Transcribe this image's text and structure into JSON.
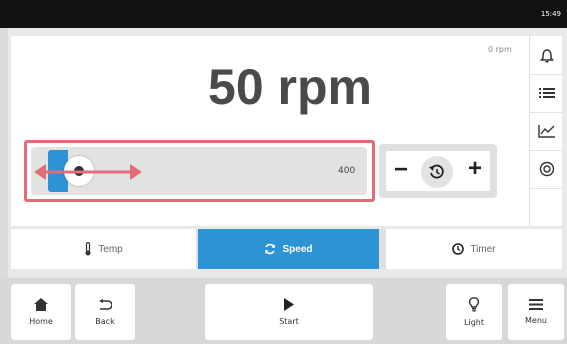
{
  "status_bar": {
    "time": "15:49"
  },
  "display": {
    "current_speed": "0 rpm",
    "setpoint": "50 rpm"
  },
  "slider": {
    "max_label": "400",
    "value_fraction": 0.125
  },
  "right_toolbar": {
    "icons": [
      "bell-icon",
      "list-icon",
      "chart-icon",
      "record-icon"
    ]
  },
  "tabs": [
    {
      "label": "Temp",
      "icon": "thermometer-icon",
      "active": false
    },
    {
      "label": "Speed",
      "icon": "rotate-icon",
      "active": true
    },
    {
      "label": "Timer",
      "icon": "clock-icon",
      "active": false
    }
  ],
  "bottom_bar": {
    "home": "Home",
    "back": "Back",
    "start": "Start",
    "light": "Light",
    "menu": "Menu"
  },
  "colors": {
    "accent": "#2c93d4",
    "highlight": "#e26d7a",
    "text_dark": "#4a4a4a"
  }
}
